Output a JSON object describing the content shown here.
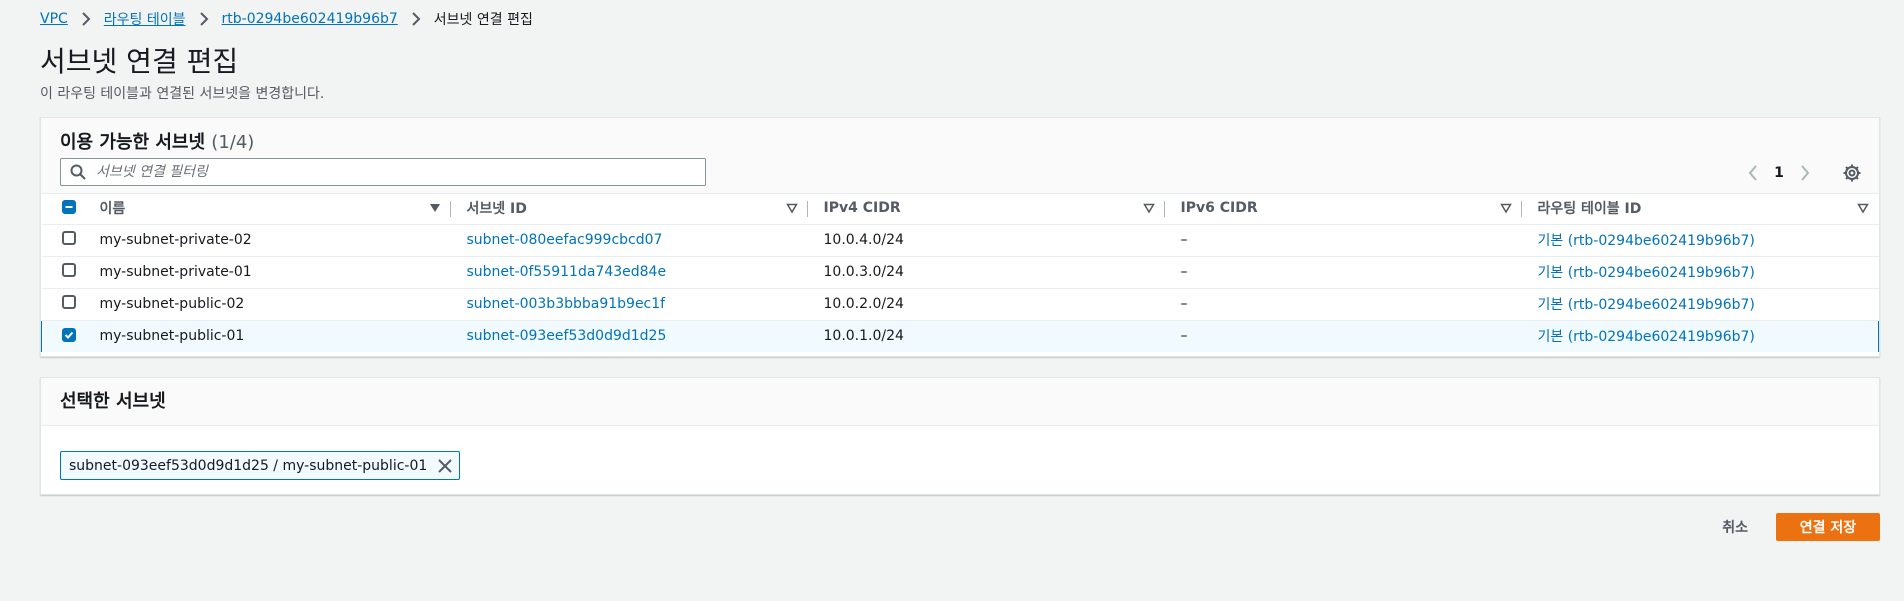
{
  "breadcrumb": {
    "items": [
      "VPC",
      "라우팅 테이블",
      "rtb-0294be602419b96b7"
    ],
    "current": "서브넷 연결 편집"
  },
  "page": {
    "title": "서브넷 연결 편집",
    "description": "이 라우팅 테이블과 연결된 서브넷을 변경합니다."
  },
  "available": {
    "title": "이용 가능한 서브넷",
    "count": "(1/4)",
    "filter_placeholder": "서브넷 연결 필터링",
    "page_number": "1",
    "columns": [
      "이름",
      "서브넷 ID",
      "IPv4 CIDR",
      "IPv6 CIDR",
      "라우팅 테이블 ID"
    ],
    "rows": [
      {
        "name": "my-subnet-private-02",
        "subnet_id": "subnet-080eefac999cbcd07",
        "ipv4": "10.0.4.0/24",
        "ipv6": "–",
        "route_table": "기본 (rtb-0294be602419b96b7)",
        "checked": false
      },
      {
        "name": "my-subnet-private-01",
        "subnet_id": "subnet-0f55911da743ed84e",
        "ipv4": "10.0.3.0/24",
        "ipv6": "–",
        "route_table": "기본 (rtb-0294be602419b96b7)",
        "checked": false
      },
      {
        "name": "my-subnet-public-02",
        "subnet_id": "subnet-003b3bbba91b9ec1f",
        "ipv4": "10.0.2.0/24",
        "ipv6": "–",
        "route_table": "기본 (rtb-0294be602419b96b7)",
        "checked": false
      },
      {
        "name": "my-subnet-public-01",
        "subnet_id": "subnet-093eef53d0d9d1d25",
        "ipv4": "10.0.1.0/24",
        "ipv6": "–",
        "route_table": "기본 (rtb-0294be602419b96b7)",
        "checked": true
      }
    ]
  },
  "selected": {
    "title": "선택한 서브넷",
    "token_label": "subnet-093eef53d0d9d1d25 / my-subnet-public-01"
  },
  "actions": {
    "cancel_label": "취소",
    "save_label": "연결 저장"
  },
  "colors": {
    "link": "#0073bb",
    "primary": "#ec7211",
    "background": "#f2f3f3"
  }
}
